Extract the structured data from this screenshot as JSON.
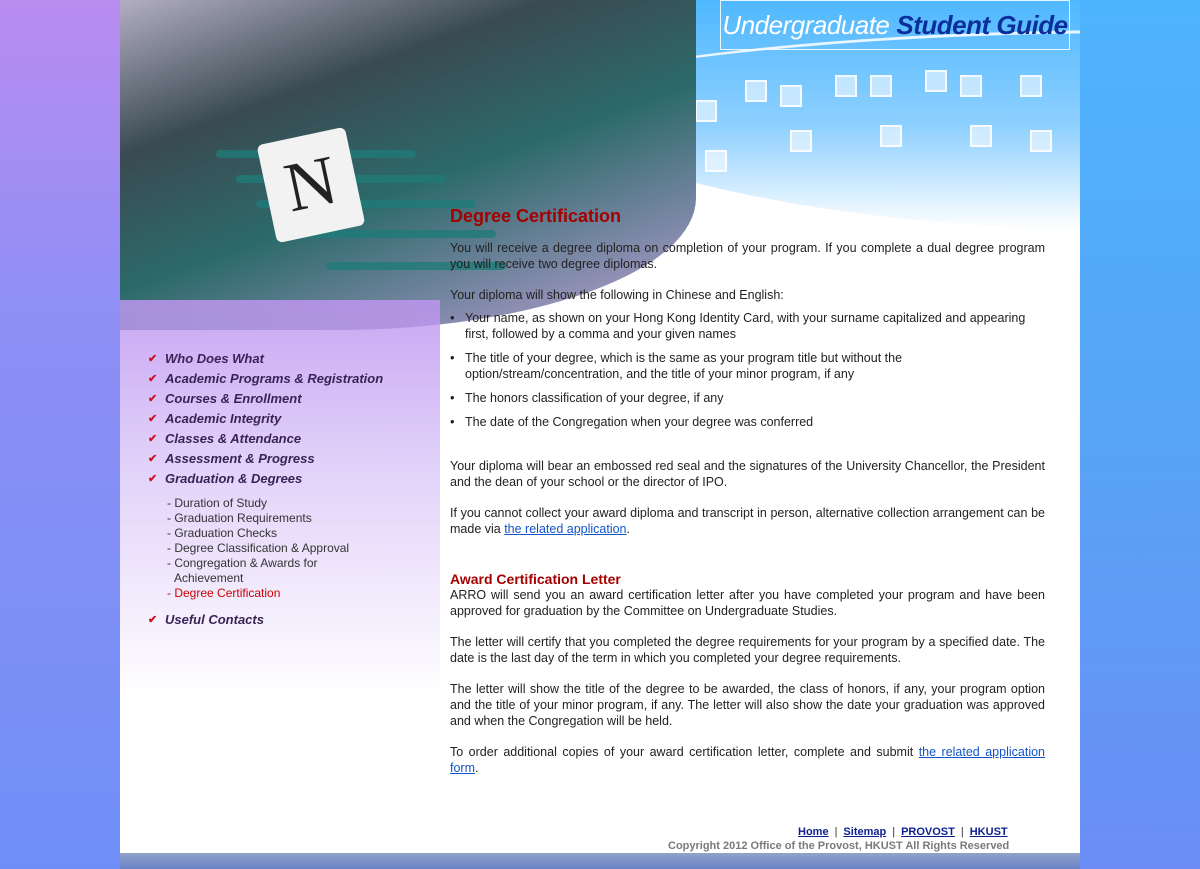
{
  "header": {
    "title_light": "Undergraduate",
    "title_bold": "Student Guide",
    "chair_letter": "N"
  },
  "nav": {
    "items": [
      {
        "label": "Who Does What"
      },
      {
        "label": "Academic Programs & Registration"
      },
      {
        "label": "Courses & Enrollment"
      },
      {
        "label": "Academic Integrity"
      },
      {
        "label": "Classes & Attendance"
      },
      {
        "label": "Assessment & Progress"
      },
      {
        "label": "Graduation & Degrees"
      }
    ],
    "sub_items": [
      {
        "label": "- Duration of Study"
      },
      {
        "label": "- Graduation Requirements"
      },
      {
        "label": "- Graduation Checks"
      },
      {
        "label": "- Degree Classification & Approval"
      },
      {
        "label": "- Congregation & Awards for",
        "label2": "Achievement"
      },
      {
        "label": "- Degree Certification"
      }
    ],
    "last_item": {
      "label": "Useful Contacts"
    }
  },
  "main": {
    "heading": "Degree Certification",
    "para1": "You will receive a degree diploma on completion of your program. If you complete a dual degree program you will receive two degree diplomas.",
    "para2": "Your diploma will show the following in Chinese and English:",
    "bullets": [
      "Your name, as shown on your Hong Kong Identity Card, with your surname capitalized and appearing first, followed by a comma and your given names",
      "The title of your degree, which is the same as your program title but without the option/stream/concentration, and the title of your minor program, if any",
      "The honors classification of your degree, if any",
      "The date of the Congregation when your degree was conferred"
    ],
    "para3": "Your diploma will bear an embossed red seal and the signatures of the University Chancellor, the President and the dean of your school or the director of IPO.",
    "para4_before": "If you cannot collect your award diploma and transcript in person, alternative collection arrangement can be made via ",
    "para4_link": "the related application",
    "para4_after": ".",
    "heading2": "Award Certification Letter",
    "para5": "ARRO will send you an award certification letter after you have completed your program and have been approved for graduation by the Committee on Undergraduate Studies.",
    "para6": "The letter will certify that you completed the degree requirements for your program by a specified date. The date is the last day of the term in which you completed your degree requirements.",
    "para7": "The letter will show the title of the degree to be awarded, the class of honors, if any, your program option and the title of your minor program, if any. The letter will also show the date your graduation was approved and when the Congregation will be held.",
    "para8_before": "To order additional copies of your award certification letter, complete and submit ",
    "para8_link": "the related application form",
    "para8_after": "."
  },
  "footer": {
    "links": [
      "Home",
      "Sitemap",
      "PROVOST",
      "HKUST"
    ],
    "separator": "|",
    "copyright": "Copyright 2012 Office of the Provost, HKUST   All Rights Reserved"
  },
  "colors": {
    "heading": "#a40000",
    "link": "#1155cc",
    "nav_text": "#3a2456",
    "active_sub": "#cc0000"
  }
}
